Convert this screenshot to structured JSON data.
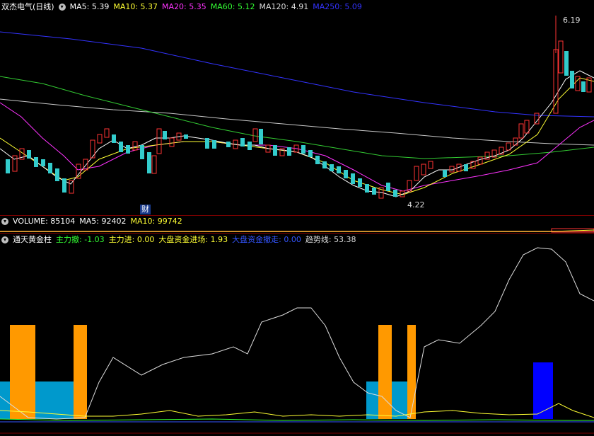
{
  "main_panel": {
    "stock_name": "双杰电气(日线)",
    "ma": [
      {
        "label": "MA5:",
        "value": "5.39",
        "color": "#ffffff"
      },
      {
        "label": "MA10:",
        "value": "5.37",
        "color": "#ffff33"
      },
      {
        "label": "MA20:",
        "value": "5.35",
        "color": "#ff33ff"
      },
      {
        "label": "MA60:",
        "value": "5.12",
        "color": "#33ff33"
      },
      {
        "label": "MA120:",
        "value": "4.91",
        "color": "#dcdcdc"
      },
      {
        "label": "MA250:",
        "value": "5.09",
        "color": "#3333ff"
      }
    ],
    "high_label": "6.19",
    "low_label": "4.22",
    "event_badge": "财"
  },
  "volume_panel": {
    "title": "VOLUME:",
    "title_value": "85104",
    "ma5_label": "MA5:",
    "ma5_value": "92402",
    "ma10_label": "MA10:",
    "ma10_value": "99742"
  },
  "indicator_panel": {
    "title": "通天黄金柱",
    "items": [
      {
        "label": "主力撤:",
        "value": "-1.03",
        "color": "#33ff33"
      },
      {
        "label": "主力进:",
        "value": "0.00",
        "color": "#ffff33"
      },
      {
        "label": "大盘资金进场:",
        "value": "1.93",
        "color": "#ffff33"
      },
      {
        "label": "大盘资金撤走:",
        "value": "0.00",
        "color": "#3355ff"
      },
      {
        "label": "趋势线:",
        "value": "53.38",
        "color": "#dcdcdc"
      }
    ]
  },
  "colors": {
    "up": "#ff3333",
    "down": "#33cccc",
    "orange_bar": "#ff9900",
    "cyan_bar": "#0099cc",
    "blue_bar": "#0000ff",
    "separator": "#7a0000"
  }
}
